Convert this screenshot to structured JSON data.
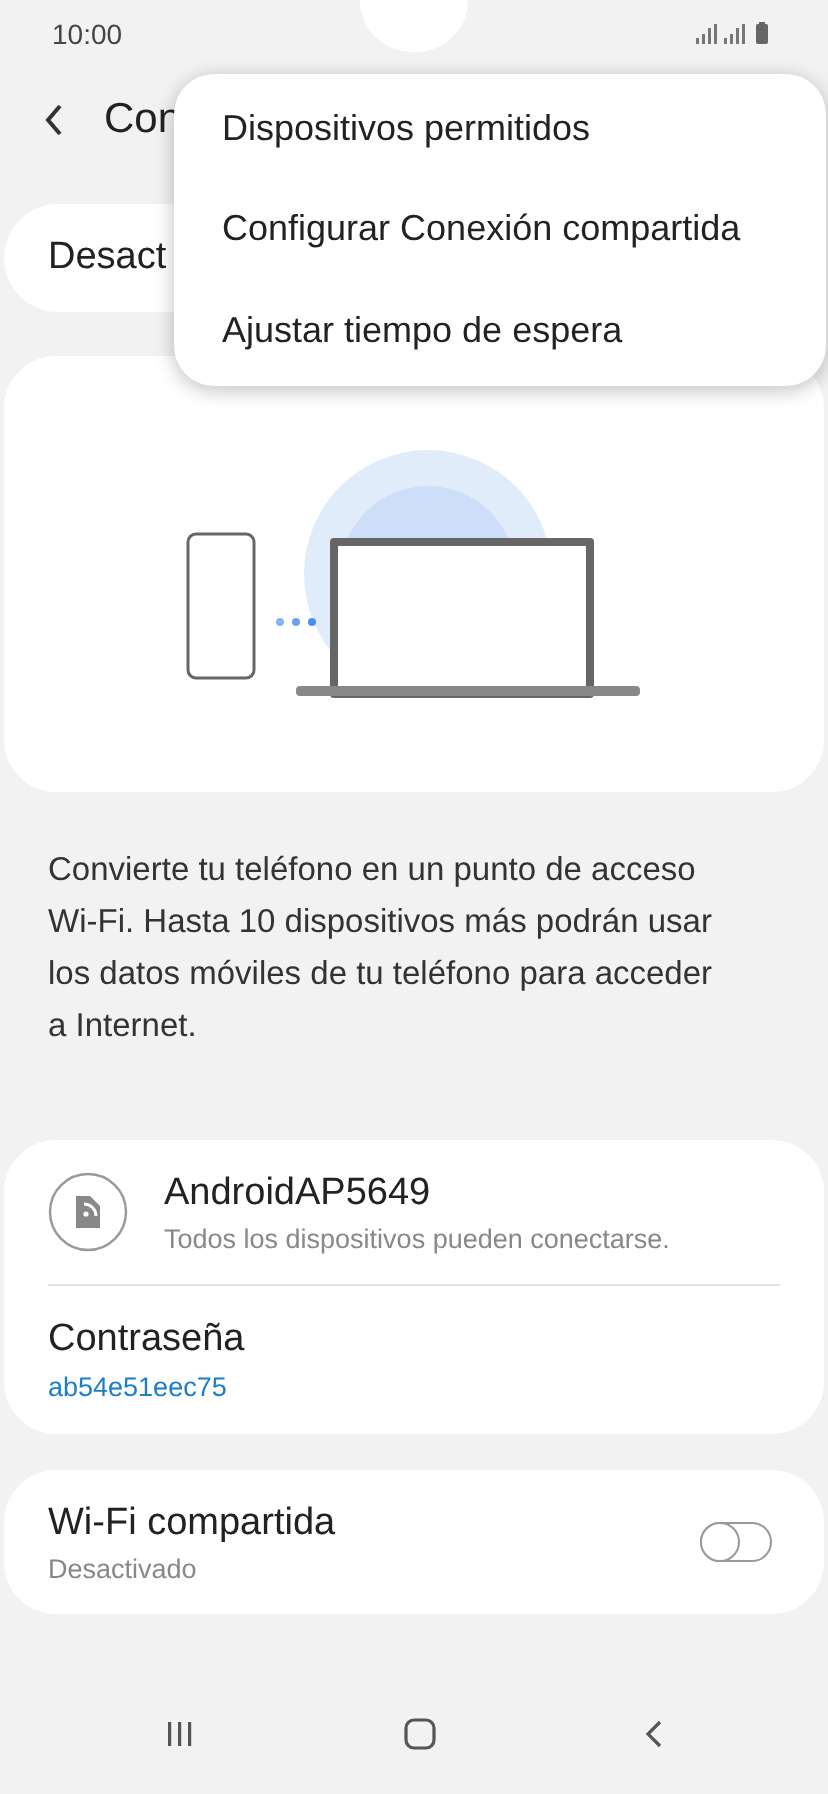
{
  "status_bar": {
    "time": "10:00"
  },
  "header": {
    "title": "Con"
  },
  "master_switch": {
    "label": "Desact"
  },
  "menu": {
    "items": [
      {
        "label": "Dispositivos permitidos"
      },
      {
        "label": "Configurar Conexión compartida"
      },
      {
        "label": "Ajustar tiempo de espera"
      }
    ]
  },
  "description": "Convierte tu teléfono en un punto de acceso Wi-Fi. Hasta 10 dispositivos más podrán usar los datos móviles de tu teléfono para acceder a Internet.",
  "network": {
    "name": "AndroidAP5649",
    "subtitle": "Todos los dispositivos pueden conectarse.",
    "password_label": "Contraseña",
    "password": "ab54e51eec75"
  },
  "wifi_sharing": {
    "label": "Wi-Fi compartida",
    "status": "Desactivado",
    "on": false
  }
}
